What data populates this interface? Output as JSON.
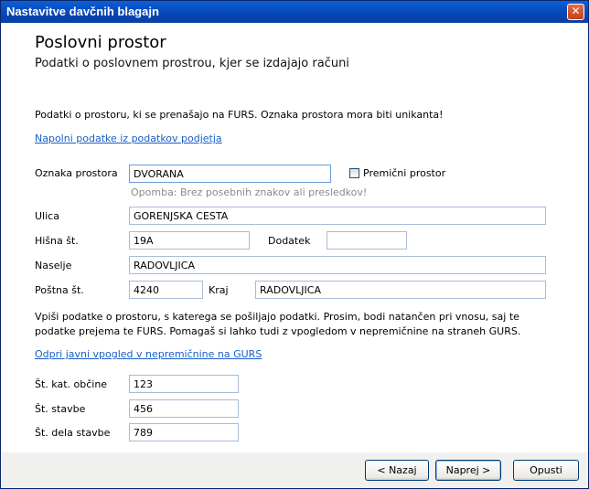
{
  "window": {
    "title": "Nastavitve davčnih blagajn",
    "close_glyph": "✕"
  },
  "header": {
    "title": "Poslovni prostor",
    "subtitle": "Podatki o poslovnem prostrou, kjer se izdajajo računi"
  },
  "intro_text": "Podatki o prostoru, ki se prenašajo na FURS. Oznaka prostora mora biti unikanta!",
  "fill_link": "Napolni podatke iz podatkov podjetja",
  "form": {
    "oznaka": {
      "label": "Oznaka prostora",
      "value": "DVORANA"
    },
    "premicni": {
      "label": "Premični prostor",
      "checked": false
    },
    "oznaka_hint": "Opomba: Brez posebnih znakov ali presledkov!",
    "ulica": {
      "label": "Ulica",
      "value": "GORENJSKA CESTA"
    },
    "hisna": {
      "label": "Hišna št.",
      "value": "19A"
    },
    "dodatek": {
      "label": "Dodatek",
      "value": ""
    },
    "naselje": {
      "label": "Naselje",
      "value": "RADOVLJICA"
    },
    "postna": {
      "label": "Poštna št.",
      "value": "4240"
    },
    "kraj": {
      "label": "Kraj",
      "value": "RADOVLJICA"
    }
  },
  "info_text": "Vpiši podatke o prostoru, s katerega se pošiljajo podatki. Prosim, bodi natančen pri vnosu, saj te podatke prejema te FURS. Pomagaš si lahko tudi z vpogledom v nepremičnine na straneh GURS.",
  "gurs_link": "Odpri javni vpogled v nepremičnine na GURS",
  "cadastre": {
    "obcina": {
      "label": "Št. kat. občine",
      "value": "123"
    },
    "stavba": {
      "label": "Št. stavbe",
      "value": "456"
    },
    "del": {
      "label": "Št. dela stavbe",
      "value": "789"
    }
  },
  "buttons": {
    "back": "< Nazaj",
    "next": "Naprej >",
    "cancel": "Opusti"
  }
}
